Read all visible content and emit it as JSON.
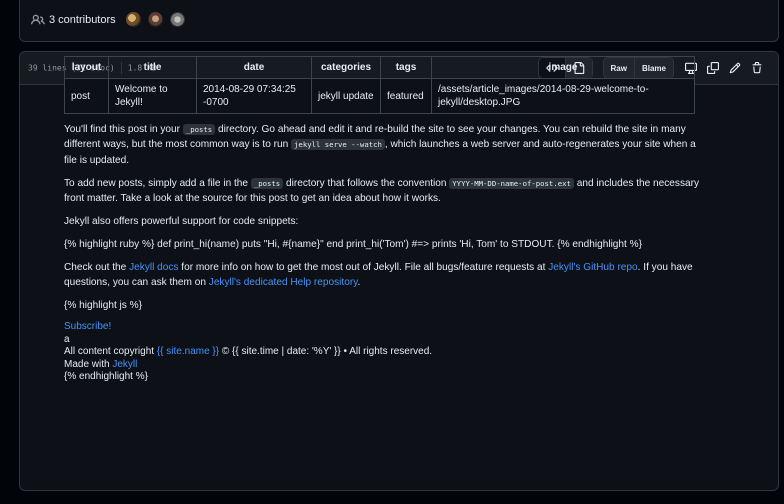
{
  "contributors": {
    "label": "3 contributors"
  },
  "file_header": {
    "lines": "39 lines (31 sloc)",
    "size": "1.8 KB",
    "raw_label": "Raw",
    "blame_label": "Blame"
  },
  "frontmatter": {
    "headers": [
      "layout",
      "title",
      "date",
      "categories",
      "tags",
      "image"
    ],
    "row": [
      "post",
      "Welcome to Jekyll!",
      "2014-08-29 07:34:25 -0700",
      "jekyll update",
      "featured",
      "/assets/article_images/2014-08-29-welcome-to-jekyll/desktop.JPG"
    ]
  },
  "body": {
    "p1_a": "You'll find this post in your ",
    "p1_code1": "_posts",
    "p1_b": " directory. Go ahead and edit it and re-build the site to see your changes. You can rebuild the site in many different ways, but the most common way is to run ",
    "p1_code2": "jekyll serve --watch",
    "p1_c": ", which launches a web server and auto-regenerates your site when a file is updated.",
    "p2_a": "To add new posts, simply add a file in the ",
    "p2_code1": "_posts",
    "p2_b": " directory that follows the convention ",
    "p2_code2": "YYYY-MM-DD-name-of-post.ext",
    "p2_c": " and includes the necessary front matter. Take a look at the source for this post to get an idea about how it works.",
    "p3": "Jekyll also offers powerful support for code snippets:",
    "p4": "{% highlight ruby %} def print_hi(name) puts \"Hi, #{name}\" end print_hi('Tom') #=> prints 'Hi, Tom' to STDOUT. {% endhighlight %}",
    "p5_a": "Check out the ",
    "p5_link1": "Jekyll docs",
    "p5_b": " for more info on how to get the most out of Jekyll. File all bugs/feature requests at ",
    "p5_link2": "Jekyll's GitHub repo",
    "p5_c": ". If you have questions, you can ask them on ",
    "p5_link3": "Jekyll's dedicated Help repository",
    "p5_d": ".",
    "p6": "{% highlight js %}",
    "subscribe": "Subscribe!",
    "a_line": "a",
    "copy_a": "All content copyright ",
    "copy_link": "{{ site.name }}",
    "copy_b": " © {{ site.time | date: '%Y' }} • All rights reserved.",
    "made_a": "Made with ",
    "made_link": "Jekyll",
    "endhl": "{% endhighlight %}"
  }
}
